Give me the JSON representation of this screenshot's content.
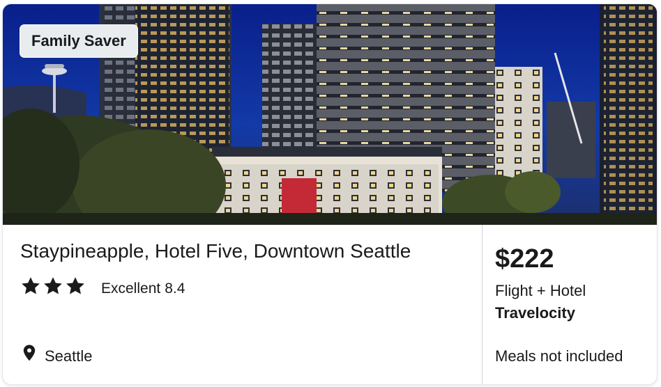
{
  "badge": "Family Saver",
  "hotel": {
    "name": "Staypineapple, Hotel Five, Downtown Seattle",
    "star_rating": 3,
    "rating_label": "Excellent",
    "rating_score": "8.4",
    "location": "Seattle"
  },
  "offer": {
    "price": "$222",
    "package": "Flight + Hotel",
    "provider": "Travelocity",
    "meals": "Meals not included"
  },
  "icons": [
    "star-icon",
    "map-pin-icon"
  ],
  "colors": {
    "text": "#1a1a1a",
    "divider": "#cfd4da",
    "badge_bg": "#e9ecef"
  }
}
